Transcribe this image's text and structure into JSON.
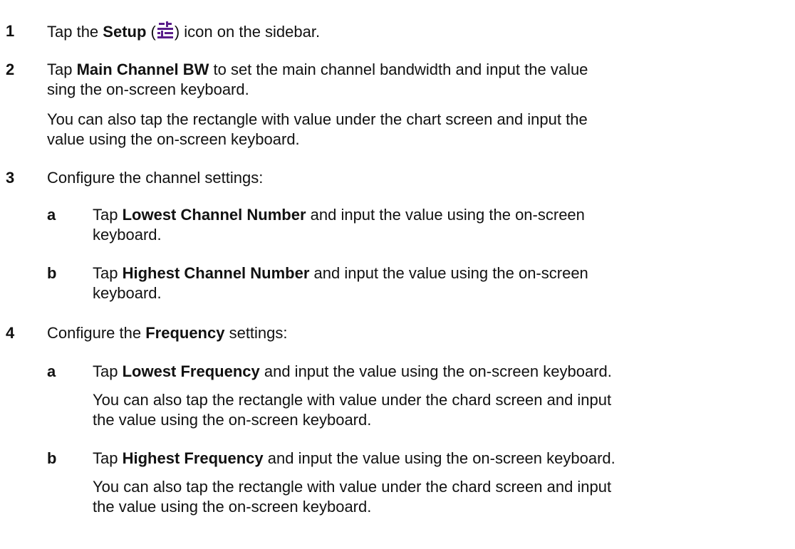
{
  "steps": [
    {
      "num": "1",
      "pre": "Tap the ",
      "bold": "Setup",
      "post_open": " (",
      "post_close": ") icon on the sidebar.",
      "icon": "setup-sliders-icon",
      "icon_color": "#5a1d8a"
    },
    {
      "num": "2",
      "pre": "Tap ",
      "bold": "Main Channel BW",
      "post": " to set the main channel bandwidth and input the value",
      "line2": "sing the on-screen keyboard.",
      "note_l1": "You can also tap the rectangle with value under the chart screen and input the",
      "note_l2": "value using the on-screen keyboard."
    },
    {
      "num": "3",
      "text": "Configure the channel settings:",
      "subs": [
        {
          "letter": "a",
          "pre": "Tap ",
          "bold": "Lowest Channel Number",
          "post": " and input the value using the on-screen",
          "line2": "keyboard."
        },
        {
          "letter": "b",
          "pre": "Tap ",
          "bold": "Highest Channel Number",
          "post": " and input the value using the on-screen",
          "line2": "keyboard."
        }
      ]
    },
    {
      "num": "4",
      "pre": "Configure the ",
      "bold": "Frequency",
      "post": " settings:",
      "subs": [
        {
          "letter": "a",
          "pre": "Tap ",
          "bold": "Lowest Frequency",
          "post": " and input the value using the on-screen keyboard.",
          "note_l1": "You can also tap the rectangle with value under the chard screen and input",
          "note_l2": "the value using the on-screen keyboard."
        },
        {
          "letter": "b",
          "pre": "Tap ",
          "bold": "Highest Frequency",
          "post": " and input the value using the on-screen keyboard.",
          "note_l1": "You can also tap the rectangle with value under the chard screen and input",
          "note_l2": "the value using the on-screen keyboard."
        }
      ]
    }
  ]
}
